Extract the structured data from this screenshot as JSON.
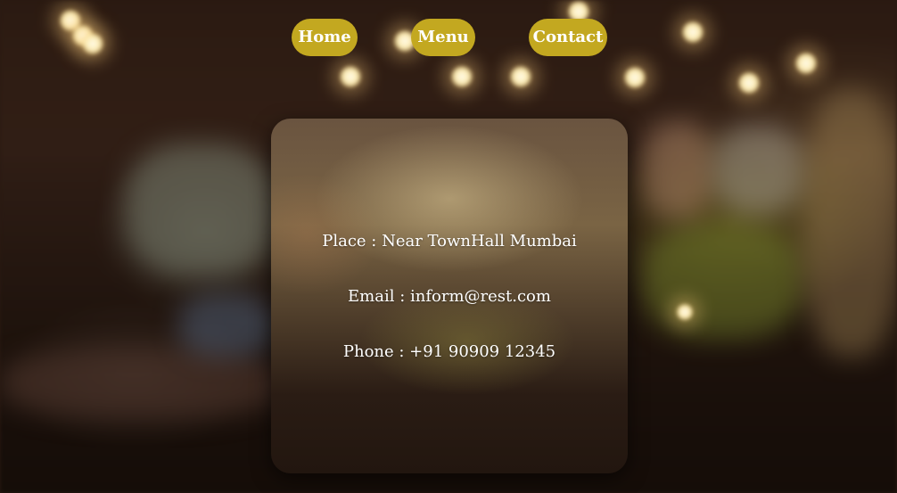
{
  "nav": {
    "home": "Home",
    "menu": "Menu",
    "contact": "Contact"
  },
  "contact_card": {
    "place": "Place : Near TownHall Mumbai",
    "email": "Email : inform@rest.com",
    "phone": "Phone : +91 90909 12345"
  },
  "colors": {
    "nav_button_bg": "#c3a820",
    "nav_button_text": "#ffffff",
    "card_text": "#ffffff"
  }
}
